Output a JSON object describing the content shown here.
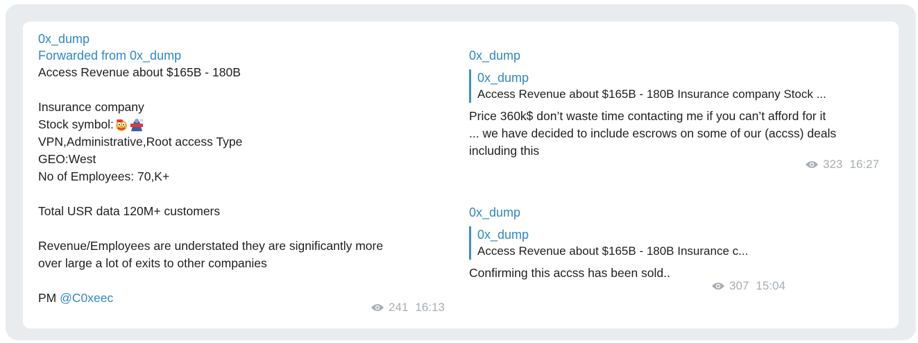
{
  "left_message": {
    "sender": "0x_dump",
    "forwarded": "Forwarded from 0x_dump",
    "lines_a": [
      "Access Revenue about $165B - 180B"
    ],
    "lines_b": [
      "Insurance company",
      "Stock symbol:",
      "VPN,Administrative,Root access Type",
      "GEO:West",
      "No of Employees: 70,K+"
    ],
    "line_total": "Total USR data 120M+ customers",
    "lines_c": [
      "Revenue/Employees are understated they are significantly more",
      "over large a lot of exits to other companies"
    ],
    "pm_label": "PM",
    "pm_handle": "@C0xeec",
    "views": "241",
    "time": "16:13"
  },
  "right_message_1": {
    "sender": "0x_dump",
    "quote_name": "0x_dump",
    "quote_text": "Access Revenue about $165B - 180B  Insurance company  Stock ...",
    "lines": [
      "Price 360k$ don’t waste time contacting me if you can’t afford for it",
      "... we have decided to include escrows on some of our (accss) deals",
      "including this"
    ],
    "views": "323",
    "time": "16:27"
  },
  "right_message_2": {
    "sender": "0x_dump",
    "quote_name": "0x_dump",
    "quote_text": "Access Revenue about $165B - 180B  Insurance c...",
    "text": "Confirming this accss has been sold..",
    "views": "307",
    "time": "15:04"
  },
  "icons": {
    "views": "eye-icon",
    "sticker": "emoji-stickers"
  },
  "colors": {
    "accent": "#2e87c5",
    "meta": "#a6adb4",
    "frame": "#e9ecef"
  }
}
